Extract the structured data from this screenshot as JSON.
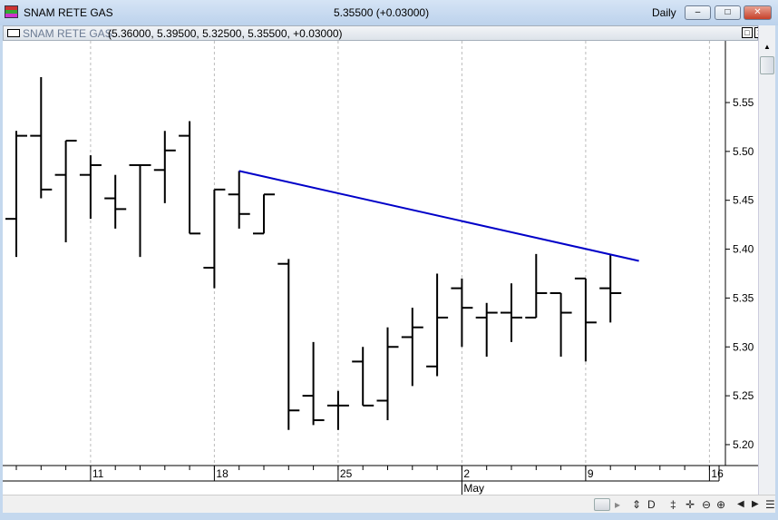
{
  "window": {
    "title": "SNAM RETE GAS",
    "quote": "5.35500 (+0.03000)",
    "period": "Daily",
    "minimize": "–",
    "maximize": "□",
    "close": "✕"
  },
  "subwindow": {
    "name": "SNAM RETE GAS",
    "values": "(5.36000, 5.39500, 5.32500, 5.35500, +0.03000)",
    "restore": "□",
    "close": "✕"
  },
  "toolbar": {
    "scroll_right": "▸",
    "items": [
      "⇕",
      "D",
      "‡",
      "✛",
      "⊖",
      "⊕",
      "◀",
      "▶",
      "☰"
    ]
  },
  "chart_data": {
    "type": "ohlc",
    "title": "SNAM RETE GAS",
    "ylim": [
      5.17,
      5.61
    ],
    "yticks": [
      "5.20",
      "5.25",
      "5.30",
      "5.35",
      "5.40",
      "5.45",
      "5.50",
      "5.55"
    ],
    "xticks": [
      {
        "label": "11",
        "index": 3
      },
      {
        "label": "18",
        "index": 8
      },
      {
        "label": "25",
        "index": 13
      },
      {
        "label": "2",
        "index": 18
      },
      {
        "label": "9",
        "index": 23
      },
      {
        "label": "16",
        "index": 28
      }
    ],
    "month_labels": [
      {
        "label": "May",
        "index": 18
      }
    ],
    "bars": [
      [
        5.431,
        5.521,
        5.392,
        5.516
      ],
      [
        5.516,
        5.576,
        5.452,
        5.461
      ],
      [
        5.476,
        5.511,
        5.407,
        5.511
      ],
      [
        5.476,
        5.496,
        5.431,
        5.486
      ],
      [
        5.452,
        5.476,
        5.421,
        5.441
      ],
      [
        5.486,
        5.486,
        5.392,
        5.486
      ],
      [
        5.481,
        5.521,
        5.447,
        5.501
      ],
      [
        5.516,
        5.531,
        5.416,
        5.416
      ],
      [
        5.381,
        5.461,
        5.36,
        5.461
      ],
      [
        5.456,
        5.48,
        5.421,
        5.436
      ],
      [
        5.416,
        5.456,
        5.416,
        5.456
      ],
      [
        5.385,
        5.39,
        5.215,
        5.235
      ],
      [
        5.25,
        5.305,
        5.22,
        5.225
      ],
      [
        5.24,
        5.255,
        5.215,
        5.24
      ],
      [
        5.285,
        5.3,
        5.24,
        5.24
      ],
      [
        5.245,
        5.32,
        5.225,
        5.3
      ],
      [
        5.31,
        5.34,
        5.26,
        5.32
      ],
      [
        5.28,
        5.375,
        5.27,
        5.33
      ],
      [
        5.36,
        5.37,
        5.3,
        5.34
      ],
      [
        5.33,
        5.345,
        5.29,
        5.335
      ],
      [
        5.335,
        5.365,
        5.305,
        5.33
      ],
      [
        5.33,
        5.395,
        5.33,
        5.355
      ],
      [
        5.355,
        5.355,
        5.29,
        5.335
      ],
      [
        5.37,
        5.37,
        5.285,
        5.325
      ],
      [
        5.36,
        5.395,
        5.325,
        5.355
      ]
    ],
    "trendline": {
      "color": "#0000c8",
      "points": [
        [
          9,
          5.48
        ],
        [
          25.15,
          5.388
        ]
      ]
    }
  }
}
